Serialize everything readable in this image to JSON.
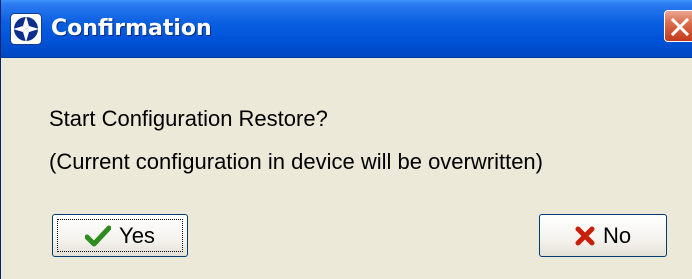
{
  "window": {
    "title": "Confirmation",
    "icon": "crosshair-compass-icon",
    "close_icon": "close-icon"
  },
  "message": {
    "line1": "Start Configuration Restore?",
    "line2": "(Current configuration in device will be overwritten)"
  },
  "buttons": {
    "yes": {
      "label": "Yes",
      "icon": "checkmark-icon",
      "icon_color": "#2E8B1E"
    },
    "no": {
      "label": "No",
      "icon": "x-cross-icon",
      "icon_color": "#C81E0A"
    }
  },
  "colors": {
    "titlebar": "#0053D8",
    "dialog_background": "#ECE9D8",
    "close_button": "#D6502E"
  }
}
